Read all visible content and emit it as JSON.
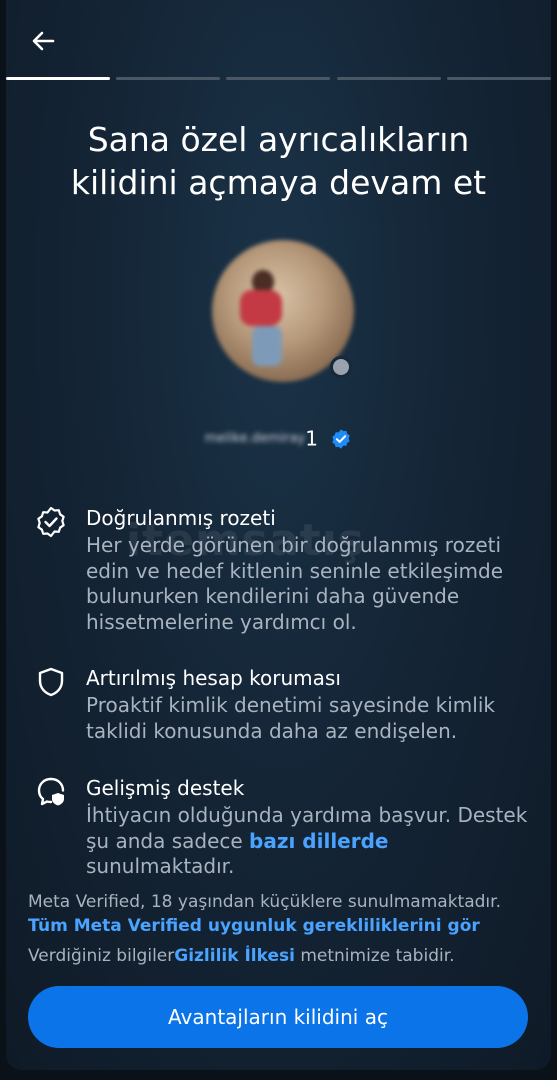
{
  "header": {
    "back_icon": "arrow-left-icon",
    "progress": {
      "total_steps": 5,
      "current_step": 1
    }
  },
  "title": {
    "line1": "Sana özel ayrıcalıkların",
    "line2": "kilidini açmaya devam et"
  },
  "profile": {
    "username_blurred": "melike.demiray",
    "username_tail": "1",
    "verified_icon": "verified-badge-icon",
    "verified_color": "#1d8cf8"
  },
  "watermark": "itemsatış",
  "features": [
    {
      "icon": "verified-badge-outline-icon",
      "title": "Doğrulanmış rozeti",
      "description": "Her yerde görünen bir doğrulanmış rozeti edin ve hedef kitlenin seninle etkileşimde bulunurken kendilerini daha güvende hissetmelerine yardımcı ol."
    },
    {
      "icon": "shield-icon",
      "title": "Artırılmış hesap koruması",
      "description": "Proaktif kimlik denetimi sayesinde kimlik taklidi konusunda daha az endişelen."
    },
    {
      "icon": "support-chat-icon",
      "title": "Gelişmiş destek",
      "description_before": "İhtiyacın olduğunda yardıma başvur. Destek şu anda sadece ",
      "description_link": "bazı dillerde",
      "description_after": " sunulmaktadır."
    }
  ],
  "footer": {
    "age_notice": "Meta Verified, 18 yaşından küçüklere sunulmamaktadır.",
    "requirements_link": "Tüm Meta Verified uygunluk gerekliliklerini gör",
    "privacy_before": "Verdiğiniz bilgiler",
    "privacy_link": "Gizlilik İlkesi",
    "privacy_after": " metnimize tabidir."
  },
  "cta": {
    "label": "Avantajların kilidini aç"
  },
  "colors": {
    "accent": "#0a74e8",
    "link": "#4aa3ff",
    "background": "#142536"
  }
}
